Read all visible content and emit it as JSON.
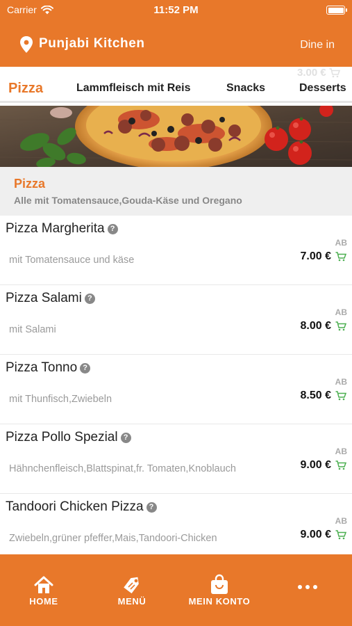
{
  "status_bar": {
    "carrier": "Carrier",
    "time": "11:52 PM"
  },
  "header": {
    "restaurant_name": "Punjabi Kitchen",
    "dine_mode": "Dine in"
  },
  "tabs": {
    "ghost_price": "3.00 €",
    "items": [
      {
        "label": "Pizza",
        "active": true
      },
      {
        "label": "Lammfleisch mit Reis",
        "active": false
      },
      {
        "label": "Snacks",
        "active": false
      },
      {
        "label": "Desserts",
        "active": false
      }
    ]
  },
  "section": {
    "title": "Pizza",
    "subtitle": "Alle mit Tomatensauce,Gouda-Käse und Oregano"
  },
  "menu_items": [
    {
      "name": "Pizza Margherita",
      "description": "mit Tomatensauce und käse",
      "prefix": "AB",
      "price": "7.00 €"
    },
    {
      "name": "Pizza Salami",
      "description": "mit Salami",
      "prefix": "AB",
      "price": "8.00 €"
    },
    {
      "name": "Pizza Tonno",
      "description": "mit Thunfisch,Zwiebeln",
      "prefix": "AB",
      "price": "8.50 €"
    },
    {
      "name": "Pizza Pollo Spezial",
      "description": "Hähnchenfleisch,Blattspinat,fr. Tomaten,Knoblauch",
      "prefix": "AB",
      "price": "9.00 €"
    },
    {
      "name": "Tandoori Chicken Pizza",
      "description": "Zwiebeln,grüner pfeffer,Mais,Tandoori-Chicken",
      "prefix": "AB",
      "price": "9.00 €"
    }
  ],
  "help_glyph": "?",
  "tab_bar": {
    "home": "HOME",
    "menu": "MENÜ",
    "account": "MEIN KONTO"
  },
  "colors": {
    "brand": "#e8782a",
    "cart": "#4caf50"
  },
  "icons": [
    "wifi-icon",
    "battery-icon",
    "location-pin-icon",
    "cart-icon",
    "help-icon",
    "home-icon",
    "tag-icon",
    "shopping-bag-icon",
    "more-icon"
  ]
}
